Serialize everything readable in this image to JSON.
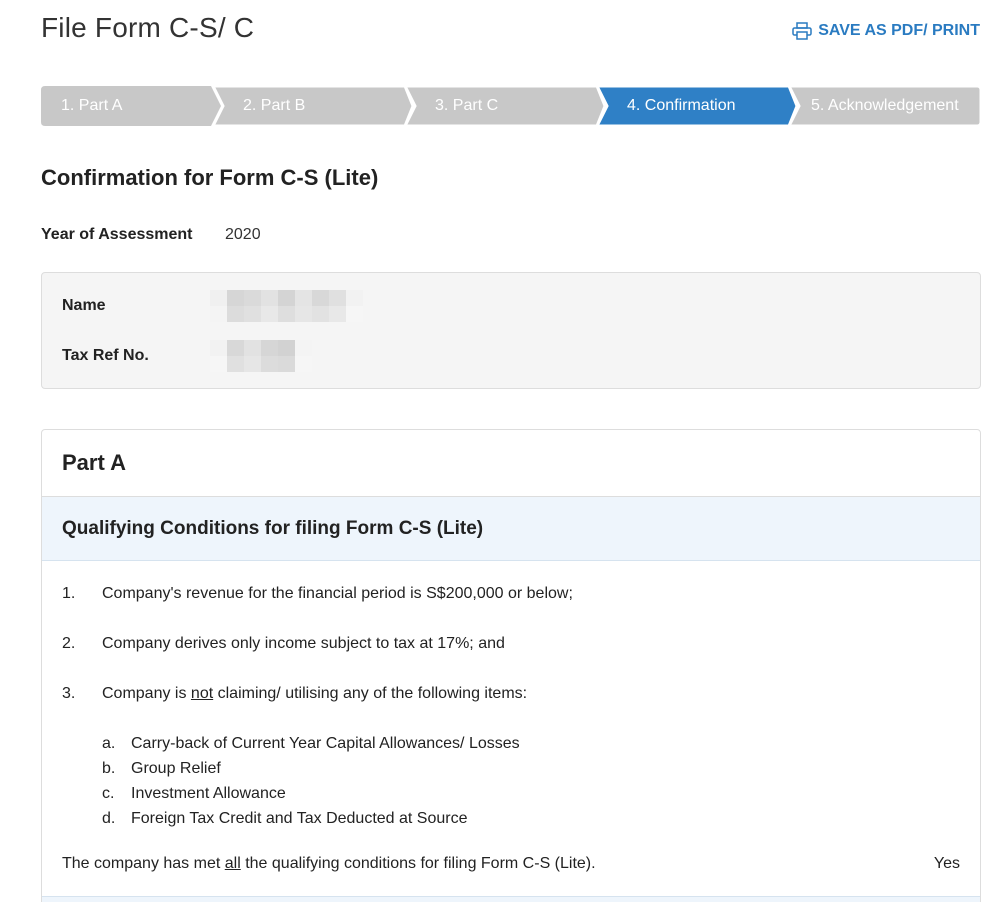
{
  "header": {
    "title": "File Form C-S/ C",
    "print_label": "SAVE AS PDF/ PRINT"
  },
  "steps": [
    {
      "label": "1.  Part A",
      "state": "completed"
    },
    {
      "label": "2.  Part B",
      "state": "completed"
    },
    {
      "label": "3.  Part C",
      "state": "completed"
    },
    {
      "label": "4.  Confirmation",
      "state": "active"
    },
    {
      "label": "5.  Acknowledgement",
      "state": "pending"
    }
  ],
  "colors": {
    "step_inactive": "#c8c8c8",
    "step_active": "#2f80c6",
    "link": "#2a7bc1"
  },
  "confirmation": {
    "title": "Confirmation for Form C-S (Lite)",
    "yoa_label": "Year of Assessment",
    "yoa_value": "2020",
    "name_label": "Name",
    "taxref_label": "Tax Ref No."
  },
  "part_a": {
    "title": "Part A",
    "subtitle": "Qualifying Conditions for filing Form C-S (Lite)",
    "conditions": [
      {
        "num": "1.",
        "text": "Company's revenue for the financial period is S$200,000 or below;"
      },
      {
        "num": "2.",
        "text": "Company derives only income subject to tax at 17%; and"
      },
      {
        "num": "3.",
        "text_before": "Company is ",
        "text_emph": "not",
        "text_after": " claiming/ utilising any of the following items:"
      }
    ],
    "sub_items": [
      {
        "letter": "a.",
        "text": "Carry-back of Current Year Capital Allowances/ Losses"
      },
      {
        "letter": "b.",
        "text": "Group Relief"
      },
      {
        "letter": "c.",
        "text": "Investment Allowance"
      },
      {
        "letter": "d.",
        "text": "Foreign Tax Credit and Tax Deducted at Source"
      }
    ],
    "statement_before": "The company has met ",
    "statement_emph": "all",
    "statement_after": " the qualifying conditions for filing Form C-S (Lite).",
    "statement_answer": "Yes"
  }
}
